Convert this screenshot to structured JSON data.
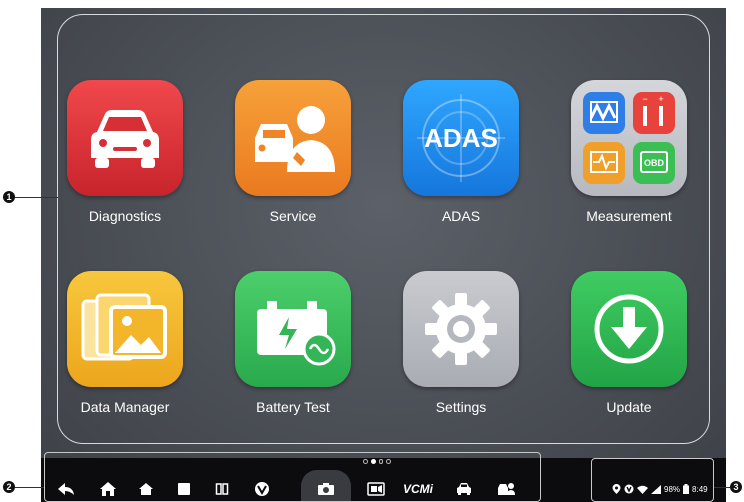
{
  "apps": [
    {
      "label": "Diagnostics",
      "icon": "car-front-icon",
      "color": "#e0343b"
    },
    {
      "label": "Service",
      "icon": "mechanic-icon",
      "color": "#f08a2a"
    },
    {
      "label": "ADAS",
      "icon": "adas-icon",
      "color": "#1f8ff0"
    },
    {
      "label": "Measurement",
      "icon": "measurement-icon",
      "color": "#c5c8cd"
    },
    {
      "label": "Data Manager",
      "icon": "photos-icon",
      "color": "#f2b62a"
    },
    {
      "label": "Battery Test",
      "icon": "battery-icon",
      "color": "#3cc062"
    },
    {
      "label": "Settings",
      "icon": "gear-icon",
      "color": "#b9bcc2"
    },
    {
      "label": "Update",
      "icon": "download-icon",
      "color": "#2dbb55"
    }
  ],
  "adas_text": "ADAS",
  "obd_text": "OBD",
  "page_indicator": {
    "count": 4,
    "active": 1
  },
  "nav_icons": [
    "back-icon",
    "home-icon",
    "home-alt-icon",
    "recent-apps-icon",
    "split-screen-icon",
    "vpn-icon",
    "camera-icon",
    "screen-record-icon",
    "vcmi-icon",
    "car-icon",
    "mechanic-icon"
  ],
  "vcm_text": "VCMi",
  "status": {
    "battery": "98%",
    "time": "8:49"
  },
  "callouts": [
    "1",
    "2",
    "3"
  ]
}
